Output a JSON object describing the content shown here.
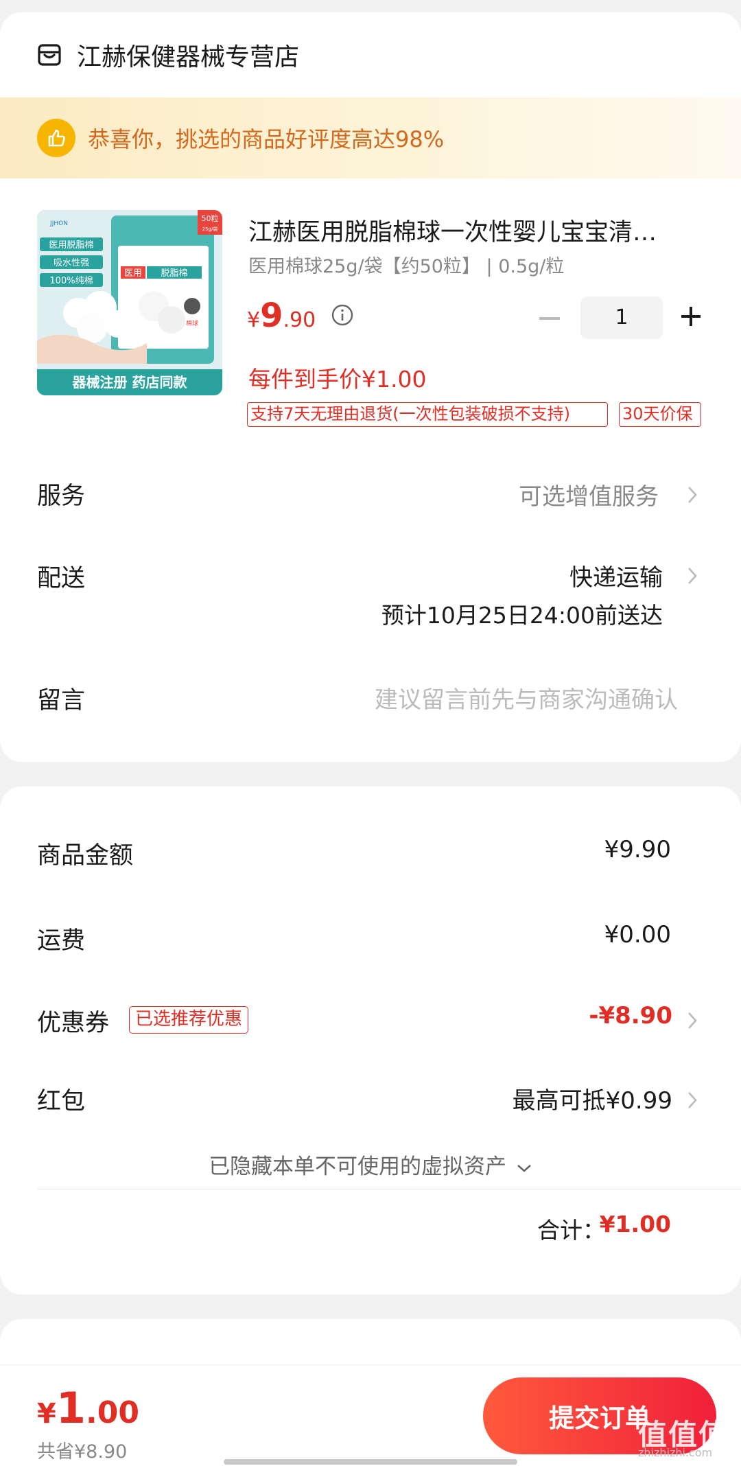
{
  "shop": {
    "name": "江赫保健器械专营店",
    "icon": "store-icon"
  },
  "promo": {
    "text": "恭喜你，挑选的商品好评度高达98%",
    "icon": "thumbs-up-icon"
  },
  "product": {
    "title": "江赫医用脱脂棉球一次性婴儿宝宝清…",
    "spec": "医用棉球25g/袋【约50粒】 | 0.5g/粒",
    "price_symbol": "¥",
    "price_int": "9",
    "price_dec": ".90",
    "quantity": "1",
    "unit_price": "每件到手价¥1.00",
    "tags": [
      "支持7天无理由退货(一次性包装破损不支持)",
      "30天价保"
    ],
    "image_text": {
      "badge": "50粒",
      "badge_sub": "25g/袋",
      "label1": "医用脱脂棉",
      "label2": "吸水性强",
      "label3": "100%纯棉",
      "pkg_title1": "医用",
      "pkg_title2": "脱脂棉",
      "pkg_tag": "棉球",
      "footer": "器械注册  药店同款",
      "brand": "JJHON"
    }
  },
  "service": {
    "label": "服务",
    "value": "可选增值服务"
  },
  "delivery": {
    "label": "配送",
    "method": "快递运输",
    "eta": "预计10月25日24:00前送达"
  },
  "message": {
    "label": "留言",
    "placeholder": "建议留言前先与商家沟通确认"
  },
  "summary": {
    "goods_label": "商品金额",
    "goods_value": "¥9.90",
    "shipping_label": "运费",
    "shipping_value": "¥0.00",
    "coupon_label": "优惠券",
    "coupon_tag": "已选推荐优惠",
    "coupon_value": "-¥8.90",
    "redpacket_label": "红包",
    "redpacket_value": "最高可抵¥0.99",
    "hidden_assets": "已隐藏本单不可使用的虚拟资产",
    "total_label": "合计：",
    "total_value": "¥1.00"
  },
  "bottom": {
    "pay_symbol": "¥",
    "pay_int": "1",
    "pay_dec": ".00",
    "saved": "共省¥8.90",
    "submit_label": "提交订单",
    "watermark": "值值值",
    "watermark_sub": "zhizhizhi.com"
  },
  "colors": {
    "accent": "#e02e24",
    "promo_text": "#d2691e",
    "button_start": "#ff5a3c",
    "button_end": "#f0203a"
  }
}
